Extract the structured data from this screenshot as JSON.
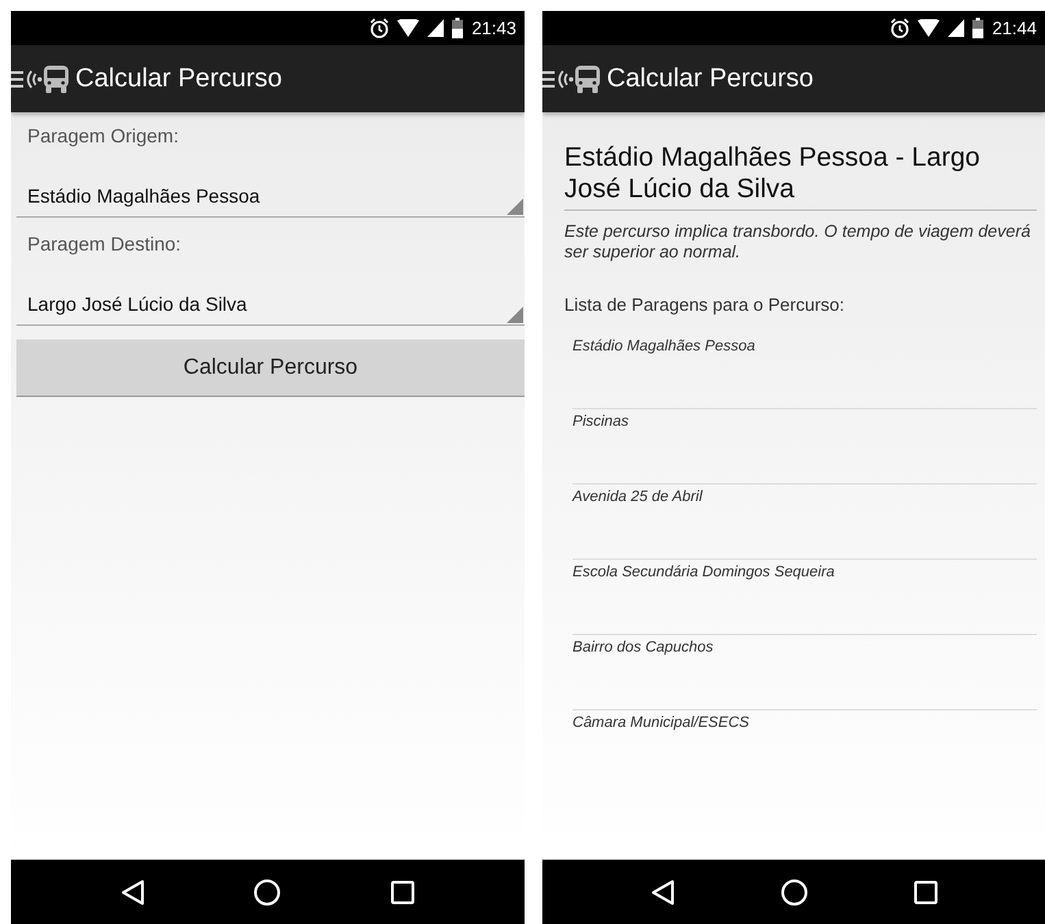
{
  "screens": [
    {
      "kind": "form",
      "status_time": "21:43",
      "title": "Calcular Percurso",
      "fields": [
        {
          "label": "Paragem Origem:",
          "value": "Estádio Magalhães Pessoa"
        },
        {
          "label": "Paragem Destino:",
          "value": "Largo José Lúcio da Silva"
        }
      ],
      "button": "Calcular Percurso"
    },
    {
      "kind": "route",
      "status_time": "21:44",
      "title": "Calcular Percurso",
      "heading": "Estádio Magalhães Pessoa - Largo José Lúcio da Silva",
      "note": "Este percurso implica transbordo. O tempo de viagem deverá ser superior ao normal.",
      "list_title": "Lista de Paragens para o Percurso:",
      "stops": [
        "Estádio Magalhães Pessoa",
        "Piscinas",
        "Avenida 25 de Abril",
        "Escola Secundária Domingos Sequeira",
        "Bairro dos Capuchos",
        "Câmara Municipal/ESECS"
      ]
    }
  ]
}
